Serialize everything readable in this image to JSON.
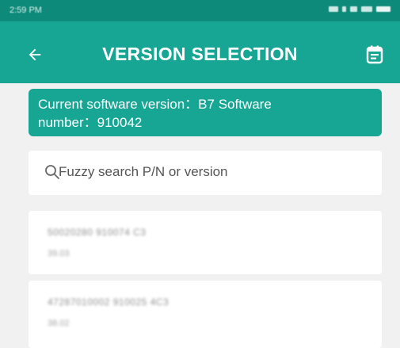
{
  "status_bar": {
    "time": "2:59 PM",
    "icons": [
      "signal-icon",
      "bluetooth-icon",
      "wifi-icon",
      "alarm-icon",
      "battery-icon"
    ]
  },
  "header": {
    "title": "VERSION SELECTION",
    "back_icon": "arrow-left-icon",
    "action_icon": "calendar-icon"
  },
  "banner": {
    "line1": "Current software version：B7 Software",
    "line2": "number：910042"
  },
  "search": {
    "icon": "search-icon",
    "placeholder": "Fuzzy search P/N or version"
  },
  "versions": [
    {
      "line1": "50020280  910074  C3",
      "line2": "39.03"
    },
    {
      "line1": "47287010002  910025  4C3",
      "line2": "38.02"
    }
  ],
  "colors": {
    "status_bar": "#0e8a7a",
    "app_bar": "#17a694",
    "banner": "#17a694",
    "background": "#f1f1f1"
  }
}
